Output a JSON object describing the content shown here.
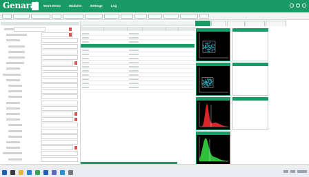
{
  "app": {
    "title": "Genaral"
  },
  "menu": [
    {
      "label": "",
      "active": true
    },
    {
      "label": "Work-Items",
      "active": false
    },
    {
      "label": "Modules",
      "active": false
    },
    {
      "label": "Settings",
      "active": false
    },
    {
      "label": "Log",
      "active": false
    }
  ],
  "colors": {
    "accent": "#1a9a66",
    "alert": "#d9534f",
    "plot_background": "#000000",
    "scatter_points": "#2bb3c7",
    "histogram_fill_1": "#d9262a",
    "histogram_fill_2": "#2fbf3a"
  },
  "icons": {
    "window_controls": [
      "settings-icon",
      "minimize-icon",
      "close-icon"
    ],
    "taskbar": [
      "start-icon",
      "search-icon",
      "file-explorer-icon",
      "browser-icon",
      "app-icon",
      "app-icon",
      "app-icon",
      "app-icon",
      "app-icon"
    ]
  },
  "plots": [
    {
      "kind": "scatter"
    },
    {
      "kind": "scatter"
    },
    {
      "kind": "histogram"
    },
    {
      "kind": "histogram"
    }
  ]
}
